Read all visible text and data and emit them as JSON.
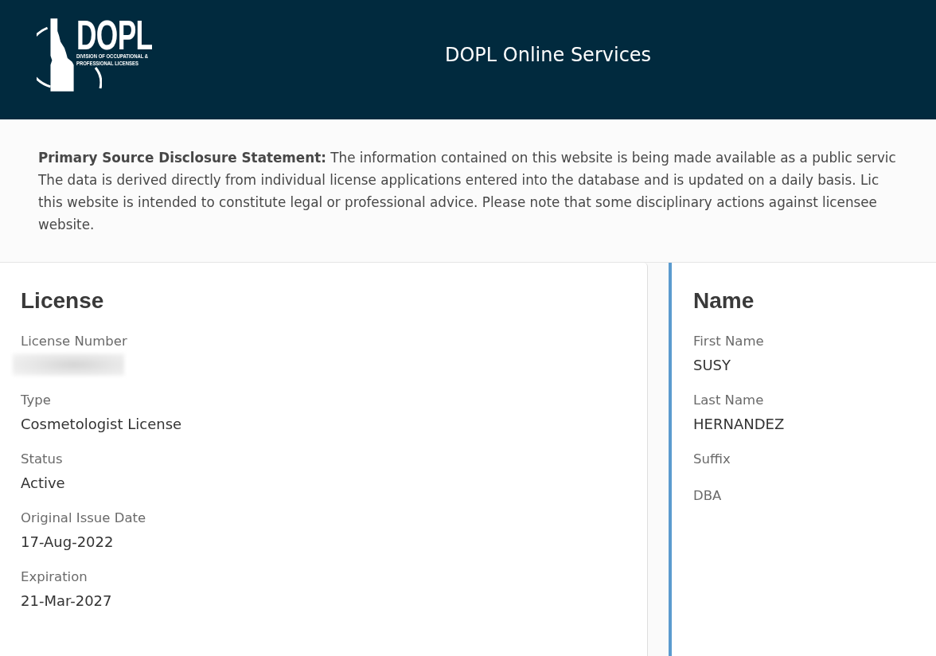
{
  "header": {
    "logo": {
      "wordmark": "DOPL",
      "subtitle": "DIVISION OF OCCUPATIONAL & PROFESSIONAL LICENSES"
    },
    "title": "DOPL Online Services"
  },
  "disclosure": {
    "lines": [
      "**Primary Source Disclosure Statement:** The information contained on this website is being made available as a public servic",
      "The data is derived directly from individual license applications entered into the database and is updated on a daily basis. Lic",
      "this website is intended to constitute legal or professional advice. Please note that some disciplinary actions against licensee",
      "website."
    ]
  },
  "panels": [
    {
      "kind": "plain",
      "title": "License",
      "fields": [
        {
          "kind": "redacted",
          "label": "License Number"
        },
        {
          "kind": "text",
          "label": "Type",
          "value": "Cosmetologist License"
        },
        {
          "kind": "text",
          "label": "Status",
          "value": "Active"
        },
        {
          "kind": "text",
          "label": "Original Issue Date",
          "value": "17-Aug-2022"
        },
        {
          "kind": "text",
          "label": "Expiration",
          "value": "21-Mar-2027"
        }
      ]
    },
    {
      "kind": "accent",
      "title": "Name",
      "fields": [
        {
          "kind": "text",
          "label": "First Name",
          "value": "SUSY"
        },
        {
          "kind": "text",
          "label": "Last Name",
          "value": "HERNANDEZ"
        },
        {
          "kind": "blank",
          "label": "Suffix"
        },
        {
          "kind": "blank",
          "label": "DBA"
        }
      ]
    }
  ]
}
